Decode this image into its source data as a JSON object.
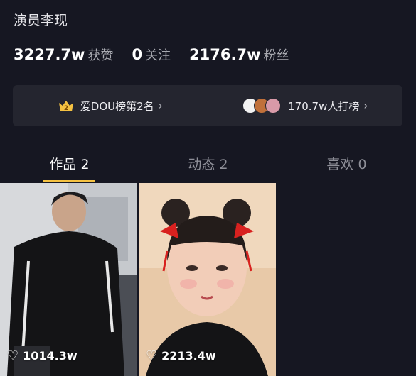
{
  "profile": {
    "bio": "演员李现"
  },
  "stats": [
    {
      "value": "3227.7w",
      "label": "获赞"
    },
    {
      "value": "0",
      "label": "关注"
    },
    {
      "value": "2176.7w",
      "label": "粉丝"
    }
  ],
  "banner": {
    "rank_text": "爱DOU榜第2名",
    "crown_number": "2",
    "supporters_text": "170.7w人打榜",
    "chevron": "›"
  },
  "tabs": [
    {
      "label": "作品 2",
      "active": true
    },
    {
      "label": "动态 2",
      "active": false
    },
    {
      "label": "喜欢 0",
      "active": false
    }
  ],
  "videos": [
    {
      "likes": "1014.3w",
      "icon": "heart-outline-icon"
    },
    {
      "likes": "2213.4w",
      "icon": "heart-outline-icon"
    }
  ],
  "colors": {
    "background": "#161722",
    "banner_bg": "#24252f",
    "tab_indicator": "#f5c242",
    "muted_text": "#a8a9b0"
  }
}
